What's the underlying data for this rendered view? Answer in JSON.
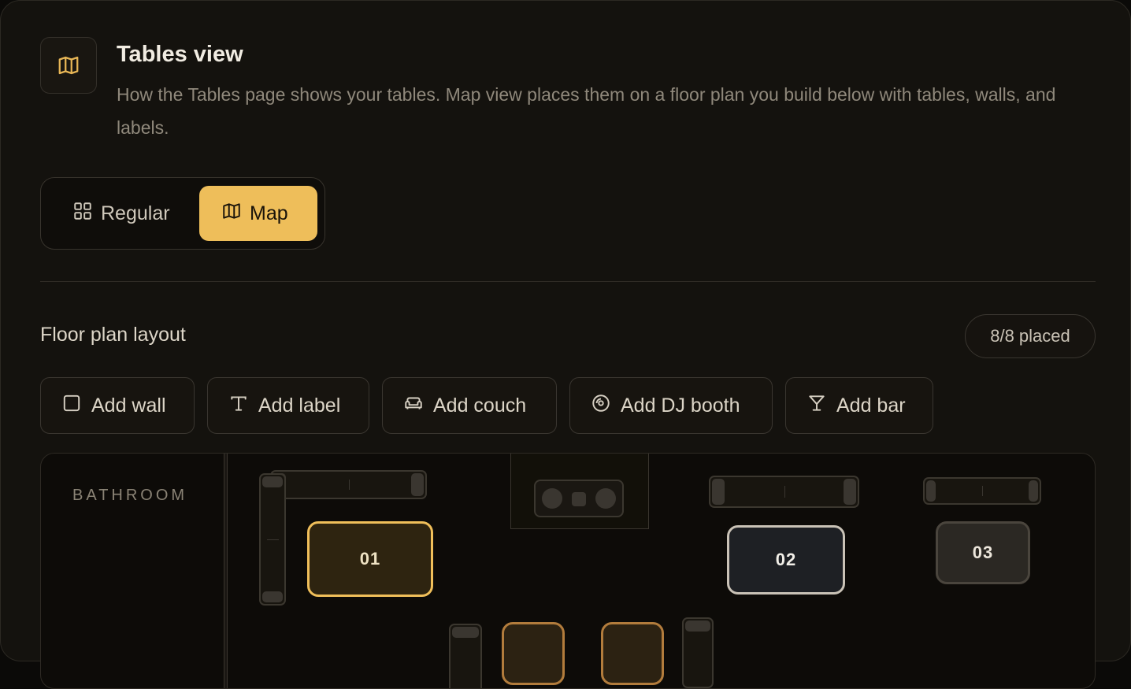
{
  "header": {
    "icon": "map-icon",
    "title": "Tables view",
    "description": "How the Tables page shows your tables. Map view places them on a floor plan you build below with tables, walls, and labels."
  },
  "view_toggle": {
    "options": [
      {
        "label": "Regular",
        "icon": "grid-icon",
        "selected": false
      },
      {
        "label": "Map",
        "icon": "map-icon",
        "selected": true
      }
    ]
  },
  "floor_plan": {
    "title": "Floor plan layout",
    "placed_badge": "8/8 placed",
    "tools": [
      {
        "label": "Add wall",
        "icon": "square-icon"
      },
      {
        "label": "Add label",
        "icon": "text-icon"
      },
      {
        "label": "Add couch",
        "icon": "couch-icon"
      },
      {
        "label": "Add DJ booth",
        "icon": "disc-icon"
      },
      {
        "label": "Add bar",
        "icon": "cocktail-icon"
      }
    ],
    "room_label": "BATHROOM",
    "tables": [
      {
        "number": "01"
      },
      {
        "number": "02"
      },
      {
        "number": "03"
      },
      {
        "number": ""
      },
      {
        "number": ""
      }
    ]
  },
  "colors": {
    "accent": "#eebe5a",
    "background": "#14120e",
    "canvas": "#0d0b08"
  }
}
